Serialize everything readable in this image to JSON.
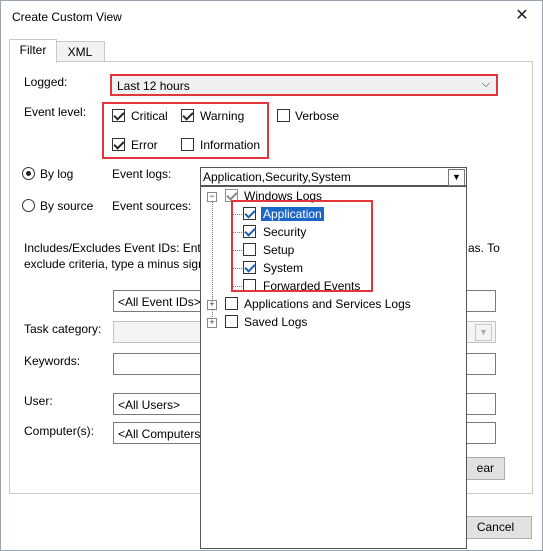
{
  "window": {
    "title": "Create Custom View"
  },
  "tabs": [
    {
      "label": "Filter"
    },
    {
      "label": "XML"
    }
  ],
  "filter": {
    "logged_label": "Logged:",
    "logged_value": "Last 12 hours",
    "event_level_label": "Event level:",
    "levels": {
      "critical": {
        "label": "Critical",
        "checked": true
      },
      "warning": {
        "label": "Warning",
        "checked": true
      },
      "verbose": {
        "label": "Verbose",
        "checked": false
      },
      "error": {
        "label": "Error",
        "checked": true
      },
      "information": {
        "label": "Information",
        "checked": false
      }
    },
    "by_log_label": "By log",
    "by_source_label": "By source",
    "event_logs_label": "Event logs:",
    "event_sources_label": "Event sources:",
    "event_logs_value": "Application,Security,System",
    "includes_text_line1": "Includes/Excludes Event IDs: Enter",
    "includes_text_line1_right": "as. To",
    "includes_text_line2": "exclude criteria, type a minus sign",
    "event_ids_placeholder": "<All Event IDs>",
    "task_category_label": "Task category:",
    "keywords_label": "Keywords:",
    "user_label": "User:",
    "user_value": "<All Users>",
    "computer_label": "Computer(s):",
    "computer_value": "<All Computers",
    "clear_label": "ear",
    "cancel_label": "Cancel"
  },
  "tree": {
    "root": {
      "label": "Windows Logs",
      "checked": true
    },
    "children": [
      {
        "label": "Application",
        "checked": true,
        "selected": true
      },
      {
        "label": "Security",
        "checked": true
      },
      {
        "label": "Setup",
        "checked": false
      },
      {
        "label": "System",
        "checked": true
      },
      {
        "label": "Forwarded Events",
        "checked": false
      }
    ],
    "apps_services": {
      "label": "Applications and Services Logs",
      "checked": false
    },
    "saved_logs": {
      "label": "Saved Logs",
      "checked": false
    }
  },
  "colors": {
    "highlight": "#e2353c",
    "selection": "#1c66c8"
  }
}
